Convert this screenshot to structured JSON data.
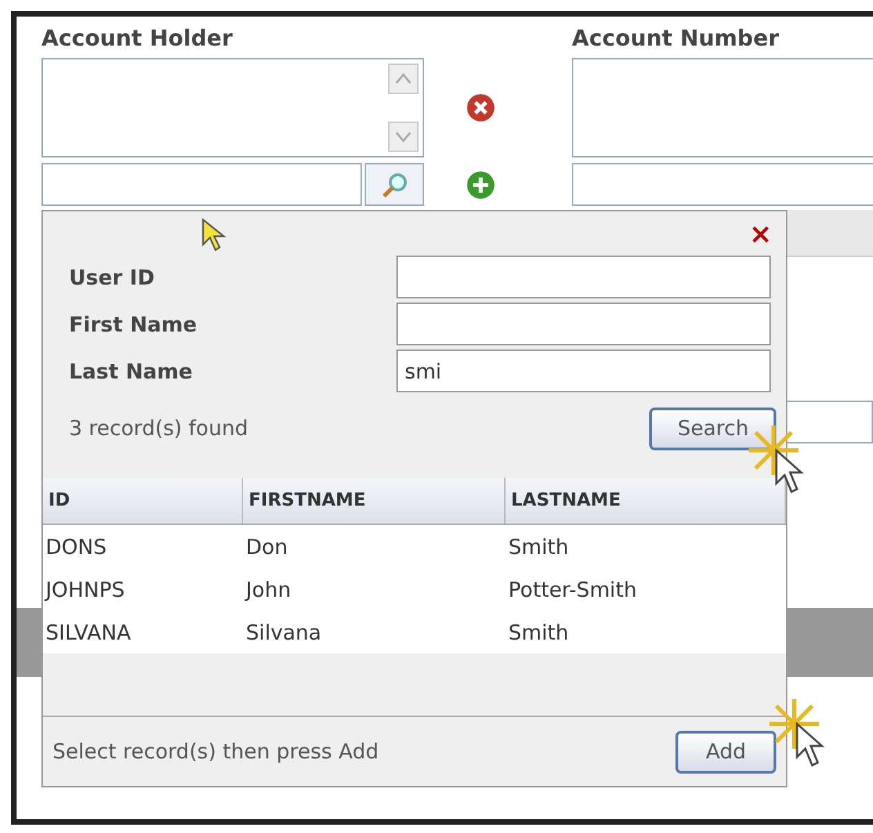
{
  "account_holder": {
    "label": "Account Holder"
  },
  "account_number": {
    "label": "Account Number"
  },
  "lookup_dialog": {
    "close": "×",
    "fields": [
      {
        "label": "User ID"
      },
      {
        "label": "First Name"
      },
      {
        "label": "Last Name",
        "value": "smi"
      }
    ],
    "status": "3 record(s) found",
    "search_button": "Search",
    "table": {
      "columns": [
        "ID",
        "FIRSTNAME",
        "LASTNAME"
      ],
      "rows": [
        [
          "DONS",
          "Don",
          "Smith"
        ],
        [
          "JOHNPS",
          "John",
          "Potter-Smith"
        ],
        [
          "SILVANA",
          "Silvana",
          "Smith"
        ]
      ]
    },
    "footer_hint": "Select record(s) then press Add",
    "add_button": "Add"
  }
}
